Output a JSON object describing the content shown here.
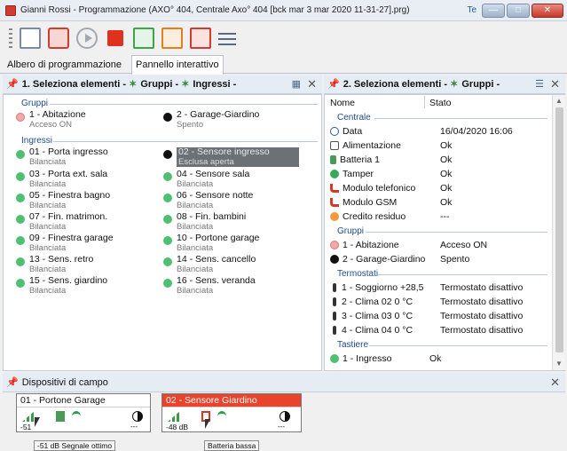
{
  "window": {
    "title": "Gianni Rossi - Programmazione (AXO° 404, Centrale Axo° 404 [bck mar 3 mar 2020  11-31-27].prg)",
    "te": "Te"
  },
  "tabs": [
    {
      "label": "Albero di programmazione"
    },
    {
      "label": "Pannello interattivo"
    }
  ],
  "left_panel": {
    "header": {
      "item1": "1. Seleziona elementi",
      "item2": "Gruppi",
      "item3": "Ingressi"
    },
    "groups_label": "Gruppi",
    "groups": [
      {
        "name": "1 - Abitazione",
        "state": "Acceso ON",
        "color": "#f4a8a8"
      },
      {
        "name": "2 - Garage-Giardino",
        "state": "Spento",
        "color": "#111111"
      }
    ],
    "inputs_label": "Ingressi",
    "inputs": [
      {
        "name": "01 - Porta ingresso",
        "state": "Bilanciata"
      },
      {
        "name": "02 - Sensore ingresso",
        "state": "Esclusa aperta"
      },
      {
        "name": "03 - Porta ext. sala",
        "state": "Bilanciata"
      },
      {
        "name": "04 - Sensore sala",
        "state": "Bilanciata"
      },
      {
        "name": "05 - Finestra bagno",
        "state": "Bilanciata"
      },
      {
        "name": "06 - Sensore notte",
        "state": "Bilanciata"
      },
      {
        "name": "07 - Fin. matrimon.",
        "state": "Bilanciata"
      },
      {
        "name": "08 - Fin. bambini",
        "state": "Bilanciata"
      },
      {
        "name": "09 - Finestra garage",
        "state": "Bilanciata"
      },
      {
        "name": "10 - Portone garage",
        "state": "Bilanciata"
      },
      {
        "name": "13 - Sens. retro",
        "state": "Bilanciata"
      },
      {
        "name": "14 - Sens. cancello",
        "state": "Bilanciata"
      },
      {
        "name": "15 - Sens. giardino",
        "state": "Bilanciata"
      },
      {
        "name": "16 - Sens. veranda",
        "state": "Bilanciata"
      }
    ]
  },
  "right_panel": {
    "header": {
      "item1": "2. Seleziona elementi",
      "item2": "Gruppi"
    },
    "col_name": "Nome",
    "col_state": "Stato",
    "centrale_label": "Centrale",
    "centrale": [
      {
        "name": "Data",
        "state": "16/04/2020 16:06",
        "icon": "clock-icon"
      },
      {
        "name": "Alimentazione",
        "state": "Ok",
        "icon": "power-icon"
      },
      {
        "name": "Batteria 1",
        "state": "Ok",
        "icon": "battery-icon"
      },
      {
        "name": "Tamper",
        "state": "Ok",
        "icon": "tamper-icon"
      },
      {
        "name": "Modulo telefonico",
        "state": "Ok",
        "icon": "phone-icon"
      },
      {
        "name": "Modulo GSM",
        "state": "Ok",
        "icon": "phone-icon"
      },
      {
        "name": "Credito residuo",
        "state": "---",
        "icon": "credit-icon"
      }
    ],
    "gruppi_label": "Gruppi",
    "gruppi": [
      {
        "name": "1 - Abitazione",
        "state": "Acceso ON"
      },
      {
        "name": "2 - Garage-Giardino",
        "state": "Spento"
      }
    ],
    "termostati_label": "Termostati",
    "termostati": [
      {
        "name": "1 - Soggiorno +28,5",
        "state": "Termostato disattivo"
      },
      {
        "name": "2 - Clima    02 0 °C",
        "state": "Termostato disattivo"
      },
      {
        "name": "3 - Clima    03 0 °C",
        "state": "Termostato disattivo"
      },
      {
        "name": "4 - Clima    04 0 °C",
        "state": "Termostato disattivo"
      }
    ],
    "tastiere_label": "Tastiere",
    "tastiere": [
      {
        "name": "1 - Ingresso",
        "state": "Ok"
      }
    ]
  },
  "devices": {
    "title": "Dispositivi di campo",
    "cards": [
      {
        "name": "01 - Portone Garage",
        "db": "-51",
        "dash": "---"
      },
      {
        "name": "02 - Sensore Giardino",
        "db": "-48 dB",
        "dash": "---"
      }
    ],
    "tooltips": [
      "-51 dB Segnale ottimo",
      "Batteria bassa"
    ]
  }
}
